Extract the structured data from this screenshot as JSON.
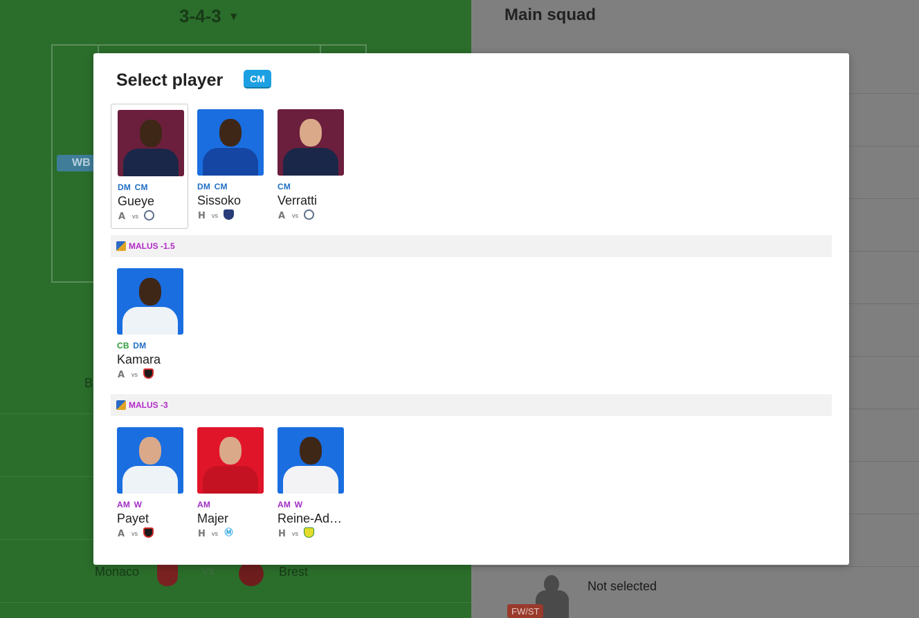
{
  "background": {
    "formation": "3-4-3",
    "left_badge": "WB",
    "left_letter": "B",
    "fixture": {
      "home": "Monaco",
      "vs": "vs",
      "away": "Brest"
    },
    "main_squad_title": "Main squad",
    "slot_badge": "FW/ST",
    "slot_status": "Not selected"
  },
  "modal": {
    "title": "Select player",
    "position_chip": "CM",
    "groups": [
      {
        "malus": "",
        "players": [
          {
            "positions": [
              "DM",
              "CM"
            ],
            "name": "Gueye",
            "venue": "A",
            "vs": "vs",
            "opponent_icon": "montpellier-crest"
          },
          {
            "positions": [
              "DM",
              "CM"
            ],
            "name": "Sissoko",
            "venue": "H",
            "vs": "vs",
            "opponent_icon": "clermont-crest"
          },
          {
            "positions": [
              "CM"
            ],
            "name": "Verratti",
            "venue": "A",
            "vs": "vs",
            "opponent_icon": "montpellier-crest"
          }
        ]
      },
      {
        "malus": "MALUS -1.5",
        "players": [
          {
            "positions": [
              "CB",
              "DM"
            ],
            "name": "Kamara",
            "venue": "A",
            "vs": "vs",
            "opponent_icon": "rennes-crest"
          }
        ]
      },
      {
        "malus": "MALUS -3",
        "players": [
          {
            "positions": [
              "AM",
              "W"
            ],
            "name": "Payet",
            "venue": "A",
            "vs": "vs",
            "opponent_icon": "rennes-crest"
          },
          {
            "positions": [
              "AM"
            ],
            "name": "Majer",
            "venue": "H",
            "vs": "vs",
            "opponent_icon": "marseille-crest"
          },
          {
            "positions": [
              "AM",
              "W"
            ],
            "name": "Reine-Ad…",
            "venue": "H",
            "vs": "vs",
            "opponent_icon": "nantes-crest"
          }
        ]
      }
    ]
  },
  "colors": {
    "pitch": "#2b6d2b",
    "accent_chip": "#1ca0e2",
    "position_dm_cm": "#1f6fc4",
    "position_cb": "#2e9a3a",
    "position_am_w": "#a12cc4",
    "malus_text": "#b329c9"
  }
}
